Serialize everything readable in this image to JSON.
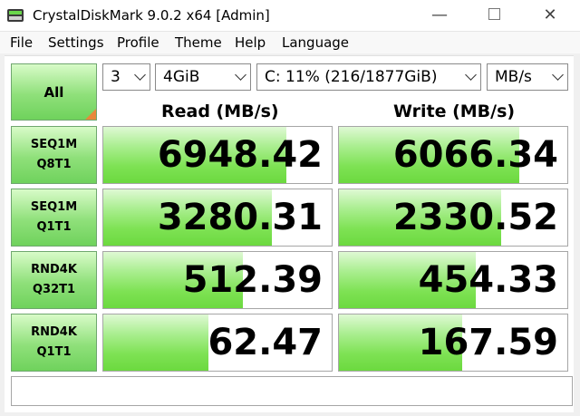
{
  "window": {
    "title": "CrystalDiskMark 9.0.2 x64 [Admin]",
    "minimize": "—",
    "close": "✕"
  },
  "menu": [
    "File",
    "Settings",
    "Profile",
    "Theme",
    "Help",
    "Language"
  ],
  "controls": {
    "all_label": "All",
    "count": "3",
    "size": "4GiB",
    "drive": "C: 11% (216/1877GiB)",
    "unit": "MB/s"
  },
  "headers": {
    "read": "Read (MB/s)",
    "write": "Write (MB/s)"
  },
  "tests": [
    {
      "line1": "SEQ1M",
      "line2": "Q8T1",
      "read": "6948.42",
      "write": "6066.34",
      "read_fill": 0.8,
      "write_fill": 0.79
    },
    {
      "line1": "SEQ1M",
      "line2": "Q1T1",
      "read": "3280.31",
      "write": "2330.52",
      "read_fill": 0.74,
      "write_fill": 0.71
    },
    {
      "line1": "RND4K",
      "line2": "Q32T1",
      "read": "512.39",
      "write": "454.33",
      "read_fill": 0.61,
      "write_fill": 0.6
    },
    {
      "line1": "RND4K",
      "line2": "Q1T1",
      "read": "62.47",
      "write": "167.59",
      "read_fill": 0.46,
      "write_fill": 0.54
    }
  ],
  "comment": "",
  "colors": {
    "bar_green": "#6cd93f",
    "button_green": "#8fe07a",
    "corner_orange": "#e8873b"
  }
}
